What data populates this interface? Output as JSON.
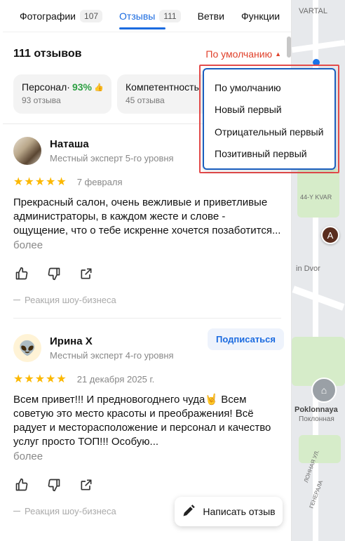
{
  "tabs": [
    {
      "label": "Фотографии",
      "count": "107"
    },
    {
      "label": "Отзывы",
      "count": "111"
    },
    {
      "label": "Ветви",
      "count": ""
    },
    {
      "label": "Функции",
      "count": ""
    }
  ],
  "summary": {
    "title": "111 отзывов",
    "sort_label": "По умолчанию"
  },
  "chips": [
    {
      "title": "Персонал·",
      "percent": "93%",
      "sub": "93 отзыва"
    },
    {
      "title": "Компетентность",
      "percent": "",
      "sub": "45 отзыва"
    }
  ],
  "dropdown": {
    "items": [
      "По умолчанию",
      "Новый первый",
      "Отрицательный первый",
      "Позитивный первый"
    ]
  },
  "reviews": [
    {
      "author": "Наташа",
      "level": "Местный эксперт 5-го уровня",
      "stars": "★★★★★",
      "date": "7 февраля",
      "text": "Прекрасный салон, очень вежливые и приветливые администраторы, в каждом жесте и слове - ощущение, что о тебе искренне хочется позаботится...",
      "more": "более",
      "reaction": "Реакция шоу-бизнеса"
    },
    {
      "author": "Ирина Х",
      "level": "Местный эксперт 4-го уровня",
      "stars": "★★★★★",
      "date": "21 декабря 2025 г.",
      "text": "Всем привет!!! И предновогоднего чуда🤘 Всем советую это место красоты и преображения! Всё радует и месторасположение и персонал и качество услуг просто ТОП!!! Особую...",
      "more": "более",
      "reaction": "Реакция шоу-бизнеса",
      "subscribe": "Подписаться",
      "avatar_glyph": "👽"
    }
  ],
  "write_review": "Написать отзыв",
  "map": {
    "labels": [
      "VARTAL",
      "44-Y KVAR",
      "in Dvor",
      "Poklonnaya",
      "Поклонная",
      "ЛОННАЯ УЛ.",
      "ГЕНЕРАЛА"
    ],
    "pin_glyph": "A"
  },
  "colors": {
    "accent": "#1b6be0",
    "sort": "#e0412b",
    "stars": "#fcb800",
    "positive": "#2ea043"
  }
}
